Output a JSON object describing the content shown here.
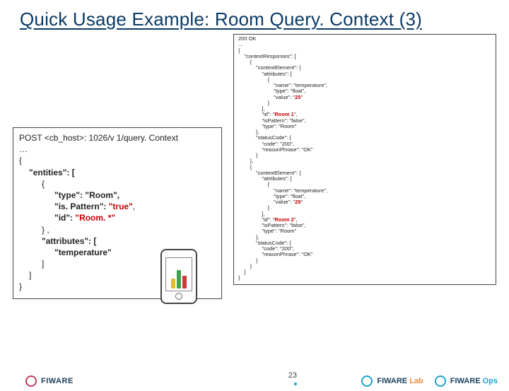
{
  "title": "Quick Usage Example: Room Query. Context (3)",
  "request": {
    "header": "POST <cb_host>: 1026/v 1/query. Context",
    "lines": [
      {
        "t": "…",
        "cls": ""
      },
      {
        "t": "{",
        "cls": ""
      },
      {
        "t": "\"entities\": [",
        "cls": "ind1 k"
      },
      {
        "t": "{",
        "cls": "ind2"
      },
      {
        "t": "\"type\": \"Room\",",
        "cls": "ind3 k"
      },
      {
        "t_html": "<span class=\"k\">\"is. Pattern\": </span><span class=\"hl\">\"true\"</span>,",
        "cls": "ind3"
      },
      {
        "t_html": "<span class=\"k\">\"id\": </span><span class=\"hl\">\"Room. *\"</span>",
        "cls": "ind3"
      },
      {
        "t": "} ,",
        "cls": "ind2"
      },
      {
        "t": "\"attributes\": [",
        "cls": "ind2 k"
      },
      {
        "t": "\"temperature\"",
        "cls": "ind3 k"
      },
      {
        "t": "]",
        "cls": "ind2"
      },
      {
        "t": "]",
        "cls": "ind1"
      },
      {
        "t": "}",
        "cls": ""
      }
    ]
  },
  "response": {
    "lines": [
      "200 OK",
      "...",
      "{",
      "    \"contextResponses\": [",
      "        {",
      "            \"contextElement\": {",
      "                \"attributes\": [",
      "                    {",
      "                        \"name\": \"temperature\",",
      "                        \"type\": \"float\",",
      "                        \"value\": \"HL25\"",
      "                    }",
      "                ],",
      "                \"id\": \"HLRoom 1\",",
      "                \"isPattern\": \"false\",",
      "                \"type\": \"Room\"",
      "            },",
      "            \"statusCode\": {",
      "                \"code\": \"200\",",
      "                \"reasonPhrase\": \"OK\"",
      "            }",
      "        },",
      "        {",
      "            \"contextElement\": {",
      "                \"attributes\": [",
      "                    {",
      "                        \"name\": \"temperature\",",
      "                        \"type\": \"float\",",
      "                        \"value\": \"HL29\"",
      "                    }",
      "                ],",
      "                \"id\": \"HLRoom 2\",",
      "                \"isPattern\": \"false\",",
      "                \"type\": \"Room\"",
      "            },",
      "            \"statusCode\": {",
      "                \"code\": \"200\",",
      "                \"reasonPhrase\": \"OK\"",
      "            }",
      "        }",
      "    ]",
      "}"
    ]
  },
  "page_number": "23",
  "footer": {
    "left": "FIWARE",
    "right1_a": "FIWARE",
    "right1_b": "Lab",
    "right2_a": "FIWARE",
    "right2_b": "Ops"
  }
}
